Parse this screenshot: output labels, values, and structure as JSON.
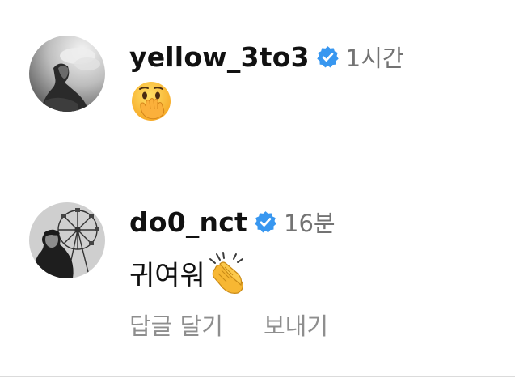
{
  "comments": [
    {
      "username": "yellow_3to3",
      "verified": true,
      "timestamp": "1시간",
      "text": "",
      "emoji": "face-with-hand-over-mouth-emoji",
      "avatar": "grayscale-profile-photo"
    },
    {
      "username": "do0_nct",
      "verified": true,
      "timestamp": "16분",
      "text": "귀여워",
      "emoji": "clapping-hands-emoji",
      "avatar": "grayscale-ferris-wheel-photo",
      "actions": {
        "reply": "답글 달기",
        "send": "보내기"
      }
    }
  ],
  "colors": {
    "username": "#111111",
    "timestamp": "#737373",
    "action_text": "#8e8e8e",
    "verified_badge": "#3897f0",
    "divider": "#dbdbdb"
  }
}
